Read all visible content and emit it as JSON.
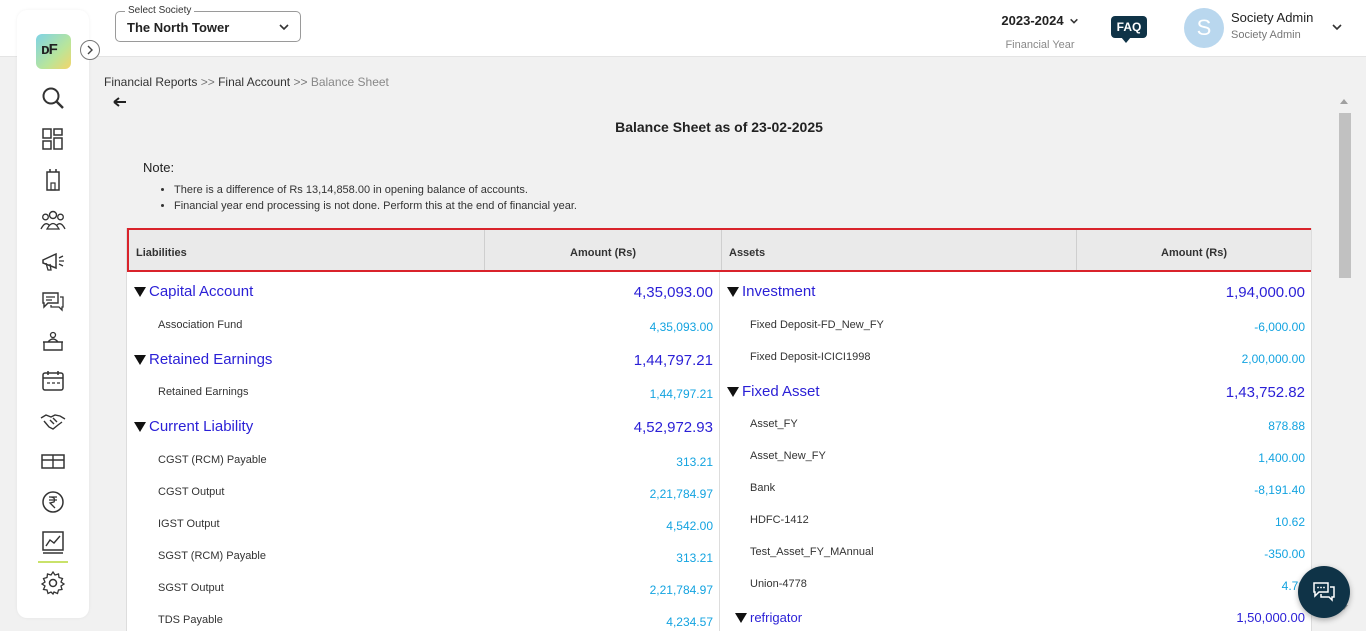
{
  "header": {
    "society_label": "Select Society",
    "society_value": "The North Tower",
    "fy_year": "2023-2024",
    "fy_label": "Financial Year",
    "faq": "FAQ",
    "avatar_letter": "S",
    "user_name": "Society Admin",
    "user_role": "Society Admin"
  },
  "sidebar": {
    "logo_text": "ᴅF",
    "icons": [
      "search-icon",
      "dashboard-icon",
      "building-icon",
      "members-icon",
      "announcement-icon",
      "chat-icon",
      "helpdesk-icon",
      "calendar-icon",
      "handshake-icon",
      "ticket-icon",
      "rupee-icon",
      "reports-icon",
      "settings-icon"
    ]
  },
  "breadcrumb": {
    "item1": "Financial Reports",
    "sep1": ">>",
    "item2": "Final Account",
    "sep2": ">>",
    "current": "Balance Sheet"
  },
  "page": {
    "title": "Balance Sheet as of 23-02-2025",
    "note_head": "Note:",
    "notes": [
      "There is a difference of Rs 13,14,858.00 in opening balance of accounts.",
      "Financial year end processing is not done. Perform this at the end of financial year."
    ]
  },
  "table": {
    "headers": {
      "liabilities": "Liabilities",
      "amount1": "Amount (Rs)",
      "assets": "Assets",
      "amount2": "Amount (Rs)"
    },
    "liabilities": [
      {
        "group": "Capital Account",
        "amount": "4,35,093.00",
        "items": [
          {
            "label": "Association Fund",
            "amount": "4,35,093.00"
          }
        ]
      },
      {
        "group": "Retained Earnings",
        "amount": "1,44,797.21",
        "items": [
          {
            "label": "Retained Earnings",
            "amount": "1,44,797.21"
          }
        ]
      },
      {
        "group": "Current Liability",
        "amount": "4,52,972.93",
        "items": [
          {
            "label": "CGST (RCM) Payable",
            "amount": "313.21"
          },
          {
            "label": "CGST Output",
            "amount": "2,21,784.97"
          },
          {
            "label": "IGST Output",
            "amount": "4,542.00"
          },
          {
            "label": "SGST (RCM) Payable",
            "amount": "313.21"
          },
          {
            "label": "SGST Output",
            "amount": "2,21,784.97"
          },
          {
            "label": "TDS Payable",
            "amount": "4,234.57"
          }
        ]
      }
    ],
    "assets": [
      {
        "group": "Investment",
        "amount": "1,94,000.00",
        "items": [
          {
            "label": "Fixed Deposit-FD_New_FY",
            "amount": "-6,000.00"
          },
          {
            "label": "Fixed Deposit-ICICI1998",
            "amount": "2,00,000.00"
          }
        ]
      },
      {
        "group": "Fixed Asset",
        "amount": "1,43,752.82",
        "items": [
          {
            "label": "Asset_FY",
            "amount": "878.88"
          },
          {
            "label": "Asset_New_FY",
            "amount": "1,400.00"
          },
          {
            "label": "Bank",
            "amount": "-8,191.40"
          },
          {
            "label": "HDFC-1412",
            "amount": "10.62"
          },
          {
            "label": "Test_Asset_FY_MAnnual",
            "amount": "-350.00"
          },
          {
            "label": "Union-4778",
            "amount": "4.72"
          }
        ]
      },
      {
        "group": "refrigator",
        "amount": "1,50,000.00",
        "items": []
      }
    ]
  },
  "colors": {
    "group_text": "#2a1fd6",
    "item_amount": "#13a3e0",
    "highlight_border": "#d9232b",
    "brand_dark": "#0f3347"
  }
}
